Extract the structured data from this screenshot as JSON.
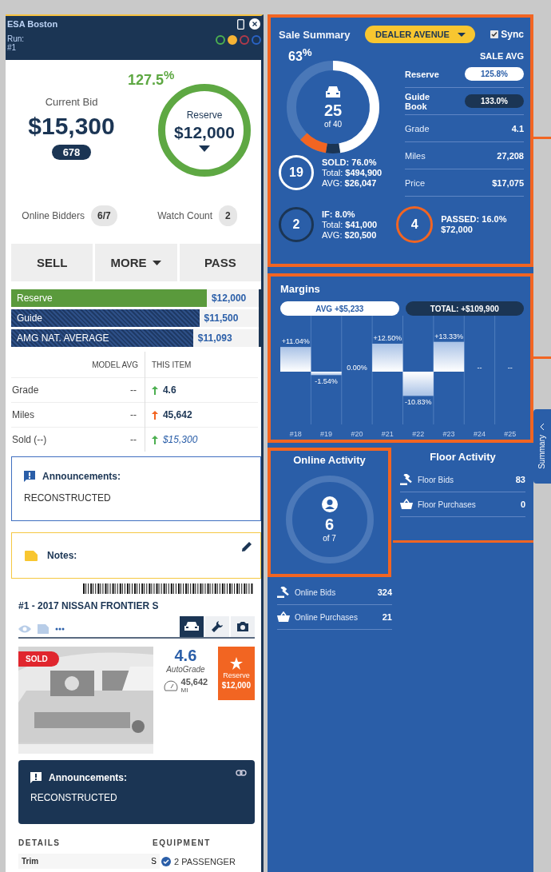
{
  "header": {
    "title": "ESA Boston",
    "run_label": "Run:",
    "run_number": "#1",
    "status_dots": [
      {
        "color": "#4caf50",
        "selected": false
      },
      {
        "color": "#f5b335",
        "selected": true
      },
      {
        "color": "#b03a4a",
        "selected": false
      },
      {
        "color": "#2a63c4",
        "selected": false
      }
    ]
  },
  "bid": {
    "label": "Current Bid",
    "amount": "$15,300",
    "badge": "678",
    "reserve_percent": "127.5$^{%}$",
    "reserve_label": "Reserve",
    "reserve_amount": "$12,000"
  },
  "counters": [
    {
      "label": "Online Bidders",
      "value": "6/7"
    },
    {
      "label": "Watch Count",
      "value": "2"
    }
  ],
  "actions": [
    {
      "label": "SELL",
      "dropdown": false
    },
    {
      "label": "MORE",
      "dropdown": true
    },
    {
      "label": "PASS",
      "dropdown": false
    }
  ],
  "price_bars": [
    {
      "label": "Reserve",
      "value": "$12,000",
      "kind": "solid",
      "level": 0.79
    },
    {
      "label": "Guide",
      "value": "$11,500",
      "kind": "striped",
      "level": 0.76
    },
    {
      "label": "AMG NAT. AVERAGE",
      "value": "$11,093",
      "kind": "striped",
      "level": 0.735
    }
  ],
  "comparison": {
    "columns": [
      "MODEL AVG",
      "THIS ITEM"
    ],
    "rows": [
      {
        "label": "Grade",
        "model_avg": "--",
        "this_item": "4.6",
        "color": "#4caf50",
        "kind": "number"
      },
      {
        "label": "Miles",
        "model_avg": "--",
        "this_item": "45,642",
        "color": "#f26522",
        "kind": "number"
      },
      {
        "label": "Sold (--)",
        "model_avg": "--",
        "this_item": "$15,300",
        "color": "#4caf50",
        "kind": "price"
      }
    ]
  },
  "announcements": {
    "title": "Announcements:",
    "text": "RECONSTRUCTED"
  },
  "notes": {
    "title": "Notes:"
  },
  "vehicle": {
    "title": "#1 - 2017 NISSAN FRONTIER S",
    "tabs": [
      {
        "kind": "car",
        "selected": true
      },
      {
        "kind": "wrench",
        "selected": false
      },
      {
        "kind": "camera",
        "selected": false
      }
    ],
    "photo": {
      "kind": "picture",
      "badge": "SOLD"
    },
    "grade": "4.6",
    "grade_label": "AutoGrade",
    "mileage": "45,642",
    "mileage_unit": "MI",
    "reserve_label": "Reserve",
    "reserve_amount": "$12,000",
    "announcements": {
      "title": "Announcements:",
      "text": "RECONSTRUCTED"
    },
    "details_heading": "DETAILS",
    "equipment_heading": "EQUIPMENT",
    "details": [
      {
        "label": "Trim",
        "value": "S"
      }
    ],
    "equipment": [
      {
        "label": "2 PASSENGER",
        "checked": true
      }
    ]
  },
  "sale_summary": {
    "title": "Sale Summary",
    "dealer": "DEALER AVENUE",
    "sync": {
      "label": "Sync",
      "checked": true
    },
    "ring": {
      "percent": "63$^{%}$",
      "count": "25",
      "of": "of 40"
    },
    "avg_heading": "SALE AVG",
    "averages": [
      {
        "label": "Reserve",
        "value": "125.8%",
        "kind": "light"
      },
      {
        "label": "Guide Book",
        "value": "133.0%",
        "kind": "dark"
      },
      {
        "label": "Grade",
        "value": "4.1",
        "kind": "plain"
      },
      {
        "label": "Miles",
        "value": "27,208",
        "kind": "plain"
      },
      {
        "label": "Price",
        "value": "$17,075",
        "kind": "plain"
      }
    ],
    "stats": [
      {
        "kind": "sold",
        "count": "19",
        "title": "SOLD: 76.0%",
        "details": [
          {
            "label": "Total:",
            "value": "$494,900"
          },
          {
            "label": "AVG:",
            "value": "$26,047"
          }
        ]
      },
      {
        "kind": "if",
        "count": "2",
        "title": "IF: 8.0%",
        "details": [
          {
            "label": "Total:",
            "value": "$41,000"
          },
          {
            "label": "AVG:",
            "value": "$20,500"
          }
        ]
      },
      {
        "kind": "passed",
        "count": "4",
        "title": "PASSED: 16.0%",
        "amount": "$72,000"
      }
    ]
  },
  "margins": {
    "title": "Margins",
    "avg_label": "AVG",
    "avg_value": "+$5,233",
    "total_label": "TOTAL:",
    "total_value": "+$109,900",
    "chart_data": {
      "type": "bar",
      "categories": [
        "#18",
        "#19",
        "#20",
        "#21",
        "#22",
        "#23",
        "#24",
        "#25"
      ],
      "values": [
        11.04,
        -1.54,
        0,
        12.5,
        -10.83,
        13.33,
        null,
        null
      ],
      "value_labels": [
        "+11.04%",
        "-1.54%",
        "0.00%",
        "+12.50%",
        "-10.83%",
        "+13.33%",
        "--",
        "--"
      ]
    }
  },
  "online_activity": {
    "title": "Online Activity",
    "count": "6",
    "of": "of 7",
    "items": [
      {
        "kind": "bids",
        "label": "Online Bids",
        "value": "324"
      },
      {
        "kind": "purchases",
        "label": "Online Purchases",
        "value": "21"
      }
    ]
  },
  "floor_activity": {
    "title": "Floor Activity",
    "items": [
      {
        "kind": "bids",
        "label": "Floor Bids",
        "value": "83"
      },
      {
        "kind": "purchases",
        "label": "Floor Purchases",
        "value": "0"
      }
    ]
  },
  "side_tab": {
    "label": "Summary"
  }
}
